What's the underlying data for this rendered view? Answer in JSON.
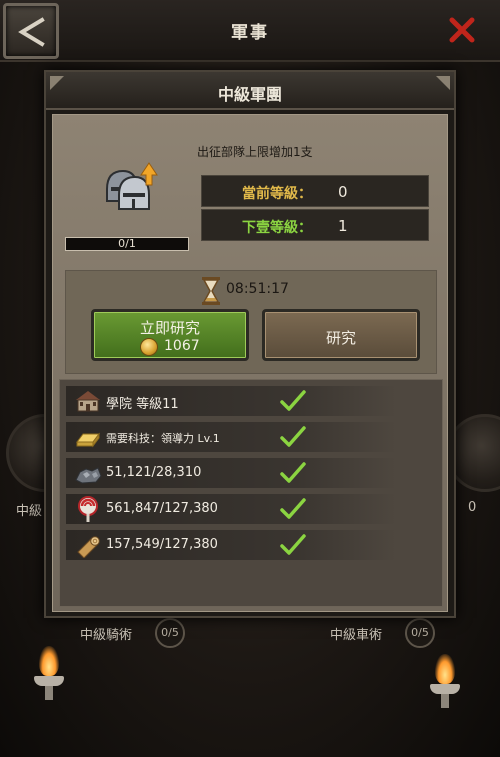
{
  "topbar": {
    "title": "軍事"
  },
  "background": {
    "left_node_label": "中級",
    "right_node_label": "0",
    "bottom_left_label": "中級騎術",
    "bottom_left_count": "0/5",
    "bottom_right_label": "中級車術",
    "bottom_right_count": "0/5"
  },
  "modal": {
    "title": "中級軍團",
    "description": "出征部隊上限增加1支",
    "progress": {
      "text": "0/1",
      "fraction": 0
    },
    "current_level": {
      "label": "當前等級：",
      "value": "0"
    },
    "next_level": {
      "label": "下壹等級：",
      "value": "1"
    },
    "timer": "08:51:17",
    "instant_button": {
      "label": "立即研究",
      "cost": "1067"
    },
    "research_button": {
      "label": "研究"
    },
    "requirements": [
      {
        "icon": "academy-icon",
        "text": "學院 等級11",
        "met": true
      },
      {
        "icon": "gold-bar-icon",
        "text": "需要科技：領導力 Lv.1",
        "met": true
      },
      {
        "icon": "iron-ore-icon",
        "text": "51,121/28,310",
        "met": true
      },
      {
        "icon": "food-icon",
        "text": "561,847/127,380",
        "met": true
      },
      {
        "icon": "wood-icon",
        "text": "157,549/127,380",
        "met": true
      }
    ]
  },
  "colors": {
    "accent_gold": "#e1b94a",
    "accent_green": "#8bd441",
    "instant_button": "#5a8a2a",
    "check": "#8bd441",
    "close_x": "#c0251b"
  }
}
